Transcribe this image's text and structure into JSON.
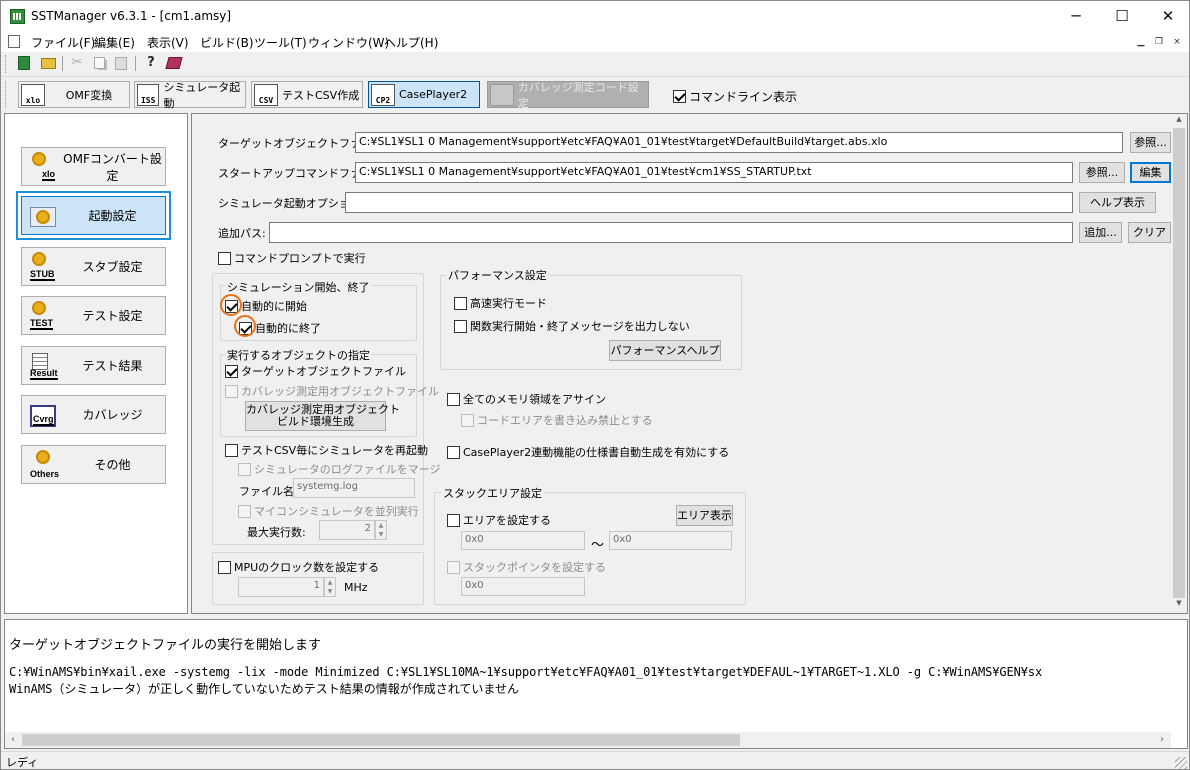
{
  "window": {
    "title": "SSTManager v6.3.1 - [cm1.amsy]",
    "minimize": "─",
    "maximize": "☐",
    "close": "✕"
  },
  "menu": [
    "ファイル(F)",
    "編集(E)",
    "表示(V)",
    "ビルド(B)",
    "ツール(T)",
    "ウィンドウ(W)",
    "ヘルプ(H)"
  ],
  "mdi": {
    "min": "▁",
    "restore": "❐",
    "close": "×"
  },
  "toolbar_icons": [
    "new-icon",
    "open-icon",
    "cut-icon",
    "copy-icon",
    "paste-icon",
    "help-icon",
    "book-icon"
  ],
  "big_toolbar": {
    "omf": "OMF変換",
    "iss": "シミュレータ起動",
    "csv": "テストCSV作成",
    "cp2": "CasePlayer2",
    "coverage_code": "カバレッジ測定コード設定",
    "cmdline_label": "コマンドライン表示",
    "icon_xlo": "xlo",
    "icon_iss": "ISS",
    "icon_csv": "CSV",
    "icon_cp2": "CP2"
  },
  "nav": [
    {
      "label": "OMFコンバート設定",
      "tag": "xlo"
    },
    {
      "label": "起動設定",
      "tag": ""
    },
    {
      "label": "スタブ設定",
      "tag": "STUB"
    },
    {
      "label": "テスト設定",
      "tag": "TEST"
    },
    {
      "label": "テスト結果",
      "tag": "Result"
    },
    {
      "label": "カバレッジ",
      "tag": "Cvrg"
    },
    {
      "label": "その他",
      "tag": "Others"
    }
  ],
  "form": {
    "target_label": "ターゲットオブジェクトファイル:",
    "target_value": "C:¥SL1¥SL1 0 Management¥support¥etc¥FAQ¥A01_01¥test¥target¥DefaultBuild¥target.abs.xlo",
    "browse1": "参照...",
    "startup_label": "スタートアップコマンドファイル:",
    "startup_value": "C:¥SL1¥SL1 0 Management¥support¥etc¥FAQ¥A01_01¥test¥cm1¥SS_STARTUP.txt",
    "browse2": "参照...",
    "edit": "編集",
    "simopt_label": "シミュレータ起動オプション:",
    "simopt_value": "",
    "helpshow": "ヘルプ表示",
    "addpath_label": "追加パス:",
    "addpath_value": "",
    "add": "追加...",
    "clear": "クリア",
    "cmdprompt": "コマンドプロンプトで実行"
  },
  "sim_group": {
    "title": "シミュレーション開始、終了",
    "auto_start": "自動的に開始",
    "auto_end": "自動的に終了"
  },
  "obj_group": {
    "title": "実行するオブジェクトの指定",
    "target_obj": "ターゲットオブジェクトファイル",
    "cov_obj": "カバレッジ測定用オブジェクトファイル",
    "build_btn_line1": "カバレッジ測定用オブジェクト",
    "build_btn_line2": "ビルド環境生成"
  },
  "restart": {
    "label": "テストCSV毎にシミュレータを再起動",
    "merge_log": "シミュレータのログファイルをマージ",
    "filename_label": "ファイル名:",
    "filename_value": "systemg.log",
    "parallel": "マイコンシミュレータを並列実行",
    "maxrun_label": "最大実行数:",
    "maxrun_value": "2"
  },
  "mpu": {
    "label": "MPUのクロック数を設定する",
    "value": "1",
    "unit": "MHz"
  },
  "perf": {
    "title": "パフォーマンス設定",
    "fast": "高速実行モード",
    "func_msg": "関数実行開始・終了メッセージを出力しない",
    "help_btn": "パフォーマンスヘルプ"
  },
  "memory": {
    "assign_all": "全てのメモリ領域をアサイン",
    "code_protect": "コードエリアを書き込み禁止とする",
    "cp2_spec": "CasePlayer2連動機能の仕様書自動生成を有効にする"
  },
  "stack": {
    "title": "スタックエリア設定",
    "set_area": "エリアを設定する",
    "show_area": "エリア表示",
    "from": "0x0",
    "tilde": "～",
    "to": "0x0",
    "set_sp": "スタックポインタを設定する",
    "sp_value": "0x0"
  },
  "log": [
    "ターゲットオブジェクトファイルの実行を開始します",
    "C:¥WinAMS¥bin¥xail.exe -systemg -lix -mode Minimized C:¥SL1¥SL10MA~1¥support¥etc¥FAQ¥A01_01¥test¥target¥DEFAUL~1¥TARGET~1.XLO -g C:¥WinAMS¥GEN¥sx",
    "WinAMS（シミュレータ）が正しく動作していないためテスト結果の情報が作成されていません"
  ],
  "status": "レディ"
}
